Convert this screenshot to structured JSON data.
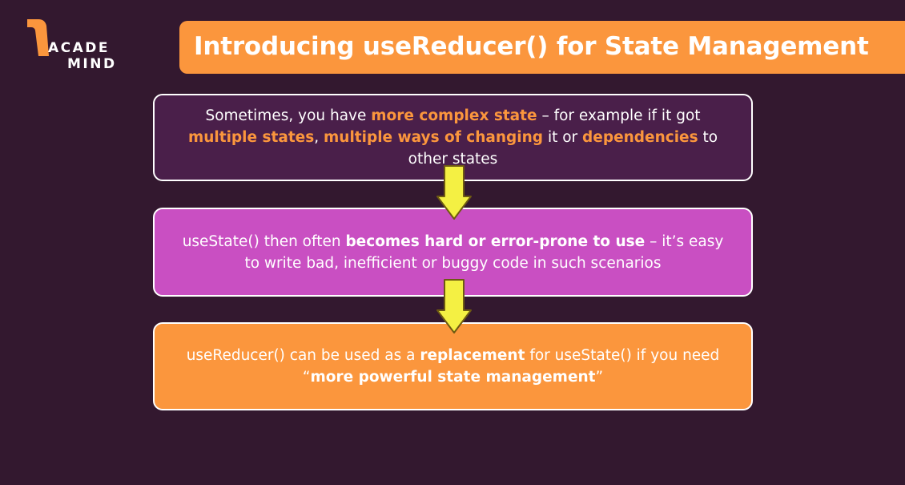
{
  "logo": {
    "line1": "ACADE",
    "line2": "MIND"
  },
  "title": "Introducing useReducer() for State Management",
  "boxes": [
    {
      "segments": [
        {
          "text": "Sometimes, you have ",
          "style": "normal"
        },
        {
          "text": "more complex state",
          "style": "highlight"
        },
        {
          "text": " – for example if it got ",
          "style": "normal"
        },
        {
          "text": "multiple states",
          "style": "highlight"
        },
        {
          "text": ", ",
          "style": "normal"
        },
        {
          "text": "multiple ways of changing",
          "style": "highlight"
        },
        {
          "text": " it or ",
          "style": "normal"
        },
        {
          "text": "dependencies",
          "style": "highlight"
        },
        {
          "text": " to other states",
          "style": "normal"
        }
      ]
    },
    {
      "segments": [
        {
          "text": "useState() then often ",
          "style": "normal"
        },
        {
          "text": "becomes hard or error-prone to use",
          "style": "bold"
        },
        {
          "text": " – it’s easy to write bad, inefficient or buggy code in such scenarios",
          "style": "normal"
        }
      ]
    },
    {
      "segments": [
        {
          "text": "useReducer() can be used as a ",
          "style": "normal"
        },
        {
          "text": "replacement",
          "style": "bold"
        },
        {
          "text": " for useState() if you need ",
          "style": "normal"
        },
        {
          "text": "“",
          "style": "normal"
        },
        {
          "text": "more powerful state management",
          "style": "bold"
        },
        {
          "text": "”",
          "style": "normal"
        }
      ]
    }
  ],
  "colors": {
    "background": "#33182f",
    "accent": "#fb963d",
    "box1": "#4a1f4a",
    "box2": "#c94fc2",
    "box3": "#fb963d",
    "arrow_fill": "#f4f043",
    "arrow_stroke": "#6e5a12"
  },
  "icons": {
    "arrows": "down-arrow-icon",
    "logo_mark": "acade-mind-logo-mark"
  }
}
